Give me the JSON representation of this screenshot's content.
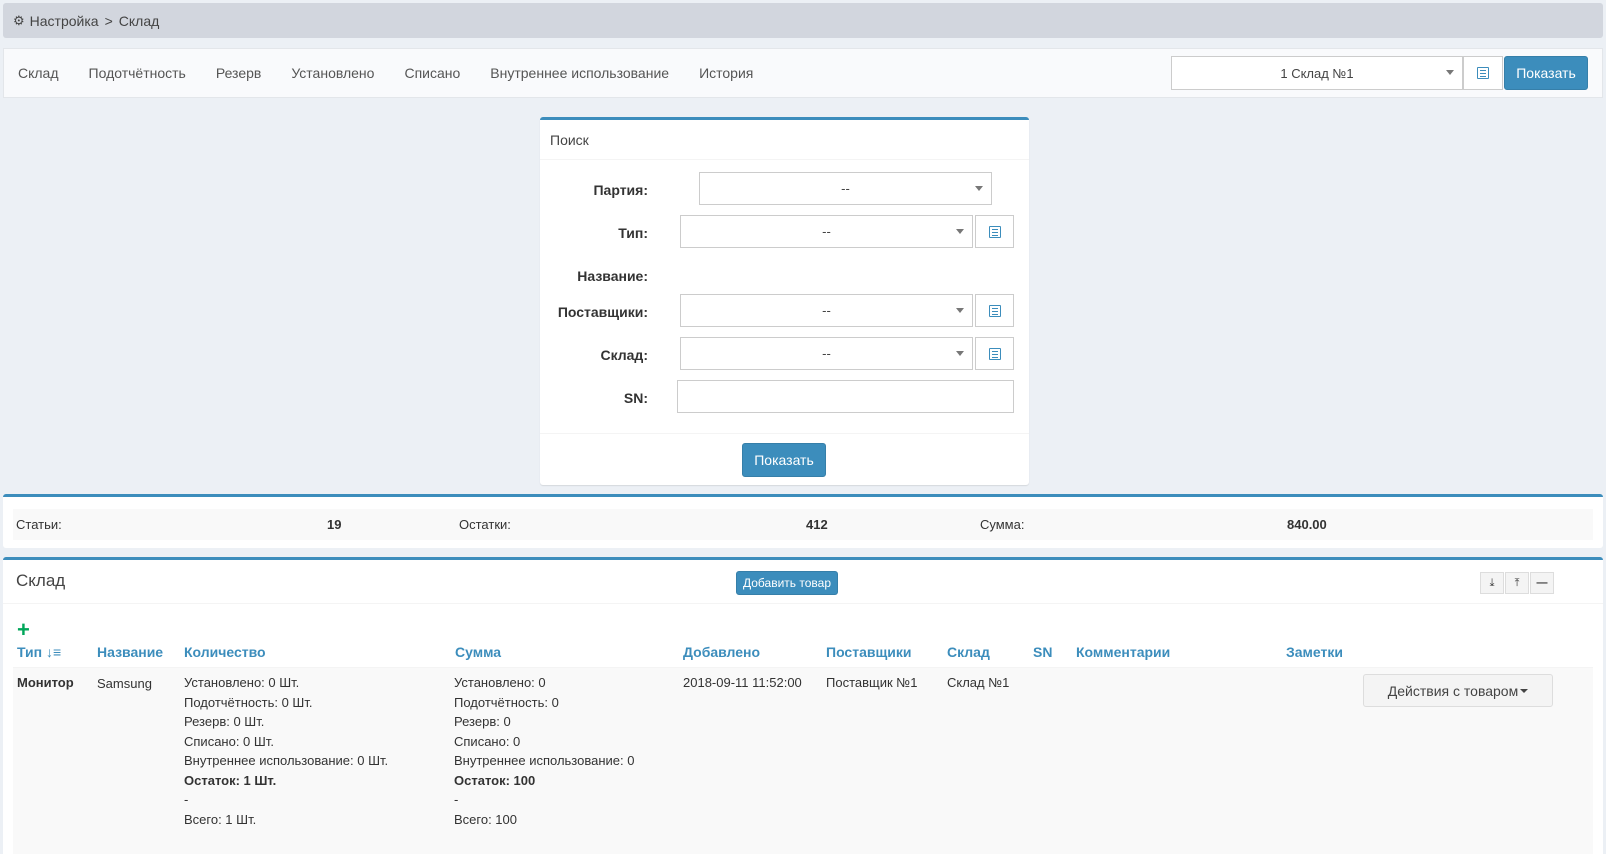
{
  "breadcrumb": {
    "root": "Настройка",
    "separator": ">",
    "current": "Склад"
  },
  "nav": {
    "tabs": [
      "Склад",
      "Подотчётность",
      "Резерв",
      "Установлено",
      "Списано",
      "Внутреннее использование",
      "История"
    ],
    "warehouse_select": "1 Склад №1",
    "show_button": "Показать"
  },
  "search": {
    "title": "Поиск",
    "fields": {
      "batch": {
        "label": "Партия:",
        "value": "--"
      },
      "type": {
        "label": "Тип:",
        "value": "--"
      },
      "name": {
        "label": "Название:"
      },
      "suppliers": {
        "label": "Поставщики:",
        "value": "--"
      },
      "warehouse": {
        "label": "Склад:",
        "value": "--"
      },
      "sn": {
        "label": "SN:",
        "value": ""
      }
    },
    "submit": "Показать"
  },
  "stats": {
    "articles_label": "Статьи:",
    "articles_value": "19",
    "remains_label": "Остатки:",
    "remains_value": "412",
    "sum_label": "Сумма:",
    "sum_value": "840.00"
  },
  "warehouse": {
    "title": "Склад",
    "add_button": "Добавить товар",
    "plus": "+",
    "columns": {
      "type": "Тип",
      "name": "Название",
      "quantity": "Количество",
      "sum": "Сумма",
      "added": "Добавлено",
      "suppliers": "Поставщики",
      "warehouse": "Склад",
      "sn": "SN",
      "comments": "Комментарии",
      "notes": "Заметки"
    },
    "rows": [
      {
        "type": "Монитор",
        "name": "Samsung",
        "quantity": {
          "installed": "Установлено: 0 Шт.",
          "accountable": "Подотчётность: 0 Шт.",
          "reserve": "Резерв: 0 Шт.",
          "written_off": "Списано: 0 Шт.",
          "internal": "Внутреннее использование: 0 Шт.",
          "remainder": "Остаток: 1 Шт.",
          "dash": "-",
          "total": "Всего: 1 Шт."
        },
        "sum": {
          "installed": "Установлено: 0",
          "accountable": "Подотчётность: 0",
          "reserve": "Резерв: 0",
          "written_off": "Списано: 0",
          "internal": "Внутреннее использование: 0",
          "remainder": "Остаток: 100",
          "dash": "-",
          "total": "Всего: 100"
        },
        "added": "2018-09-11 11:52:00",
        "supplier": "Поставщик №1",
        "warehouse": "Склад №1",
        "actions": "Действия с товаром"
      }
    ]
  },
  "icons": [
    "gear-icon",
    "list-icon",
    "caret-down-icon",
    "sort-icon",
    "export-icon",
    "import-icon",
    "collapse-icon",
    "plus-icon"
  ],
  "colors": {
    "accent": "#3c8dbc",
    "plus": "#00a65a",
    "breadcrumb_bg": "#d2d6de",
    "page_bg": "#ecf0f5"
  }
}
